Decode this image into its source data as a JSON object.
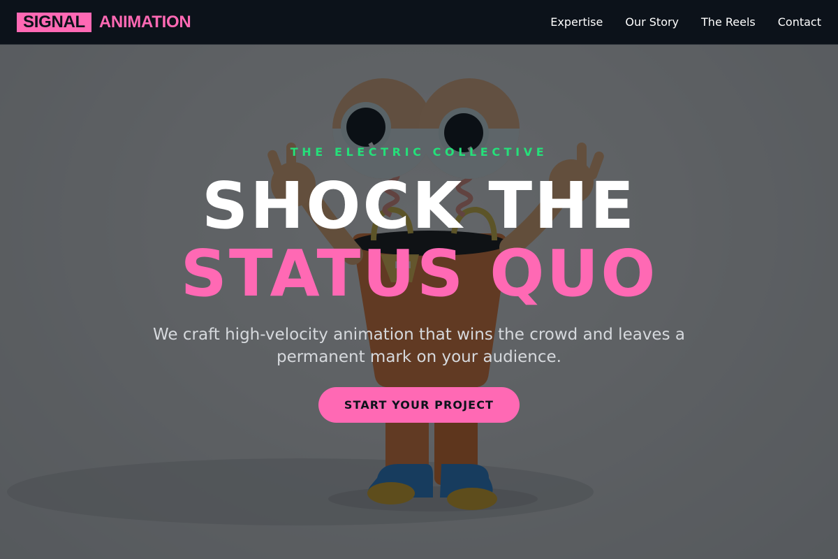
{
  "nav": {
    "logo_box": "SIGNAL",
    "logo_text": "ANIMATION",
    "links": [
      {
        "label": "Expertise"
      },
      {
        "label": "Our Story"
      },
      {
        "label": "The Reels"
      },
      {
        "label": "Contact"
      }
    ]
  },
  "hero": {
    "eyebrow": "THE ELECTRIC COLLECTIVE",
    "headline_line1": "SHOCK THE",
    "headline_line2": "STATUS QUO",
    "subtitle": "We craft high-velocity animation that wins the crowd and leaves a permanent mark on your audience.",
    "cta_label": "START YOUR PROJECT"
  },
  "colors": {
    "accent_pink": "#ff69b4",
    "accent_green": "#25e07a",
    "nav_bg": "#0c121a"
  }
}
